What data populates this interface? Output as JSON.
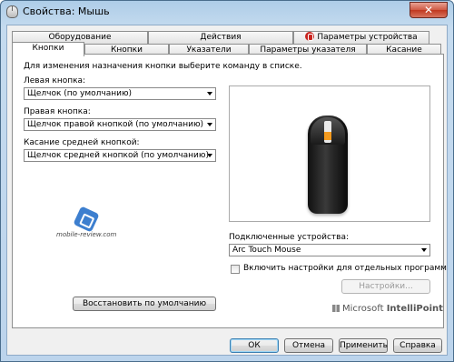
{
  "window": {
    "title": "Свойства: Мышь",
    "close_glyph": "✕"
  },
  "tabs_back": [
    {
      "label": "Оборудование"
    },
    {
      "label": "Действия"
    },
    {
      "label": "Параметры устройства",
      "icon": "intellipoint-icon"
    }
  ],
  "tabs_front": [
    {
      "label": "Кнопки",
      "active": true
    },
    {
      "label": "Кнопки"
    },
    {
      "label": "Указатели"
    },
    {
      "label": "Параметры указателя"
    },
    {
      "label": "Касание"
    }
  ],
  "panel": {
    "instruction": "Для изменения назначения кнопки выберите команду в списке.",
    "left_button_label": "Левая кнопка:",
    "left_button_value": "Щелчок (по умолчанию)",
    "right_button_label": "Правая кнопка:",
    "right_button_value": "Щелчок правой кнопкой (по умолчанию)",
    "middle_touch_label": "Касание средней кнопкой:",
    "middle_touch_value": "Щелчок средней кнопкой (по умолчанию)",
    "watermark_text": "mobile-review.com",
    "connected_label": "Подключенные устройства:",
    "connected_value": "Arc Touch Mouse",
    "per_program_label": "Включить настройки для отдельных программ",
    "per_program_checked": false,
    "settings_button": "Настройки...",
    "restore_button": "Восстановить по умолчанию",
    "brand_microsoft": "Microsoft",
    "brand_product": "IntelliPoint"
  },
  "footer": {
    "ok": "ОК",
    "cancel": "Отмена",
    "apply": "Применить",
    "help": "Справка"
  },
  "colors": {
    "accent_orange": "#f39a1e",
    "close_red": "#c0381f",
    "watermark_blue": "#3d7fcf"
  }
}
